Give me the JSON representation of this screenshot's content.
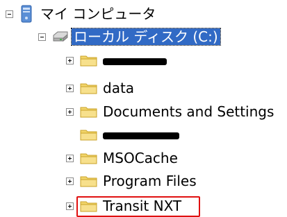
{
  "tree": {
    "root": {
      "label": "マイ コンピュータ",
      "icon": "my-computer-icon",
      "expanded": true
    },
    "drive": {
      "label": "ローカル ディスク (C:)",
      "icon": "hard-disk-icon",
      "expanded": true,
      "selected": true
    },
    "folders": [
      {
        "label": "",
        "redacted": true,
        "has_children": true,
        "icon": "folder-icon"
      },
      {
        "label": "data",
        "redacted": false,
        "has_children": true,
        "icon": "folder-icon"
      },
      {
        "label": "Documents and Settings",
        "redacted": false,
        "has_children": true,
        "icon": "folder-icon"
      },
      {
        "label": "",
        "redacted": true,
        "has_children": false,
        "icon": "folder-icon"
      },
      {
        "label": "MSOCache",
        "redacted": false,
        "has_children": true,
        "icon": "folder-icon"
      },
      {
        "label": "Program Files",
        "redacted": false,
        "has_children": true,
        "icon": "folder-icon"
      },
      {
        "label": "Transit NXT",
        "redacted": false,
        "has_children": true,
        "icon": "folder-icon",
        "highlighted": true
      }
    ]
  },
  "colors": {
    "selection_bg": "#316ac5",
    "highlight_border": "#e01010",
    "folder_fill": "#f2d56b",
    "folder_stroke": "#c9a227"
  }
}
